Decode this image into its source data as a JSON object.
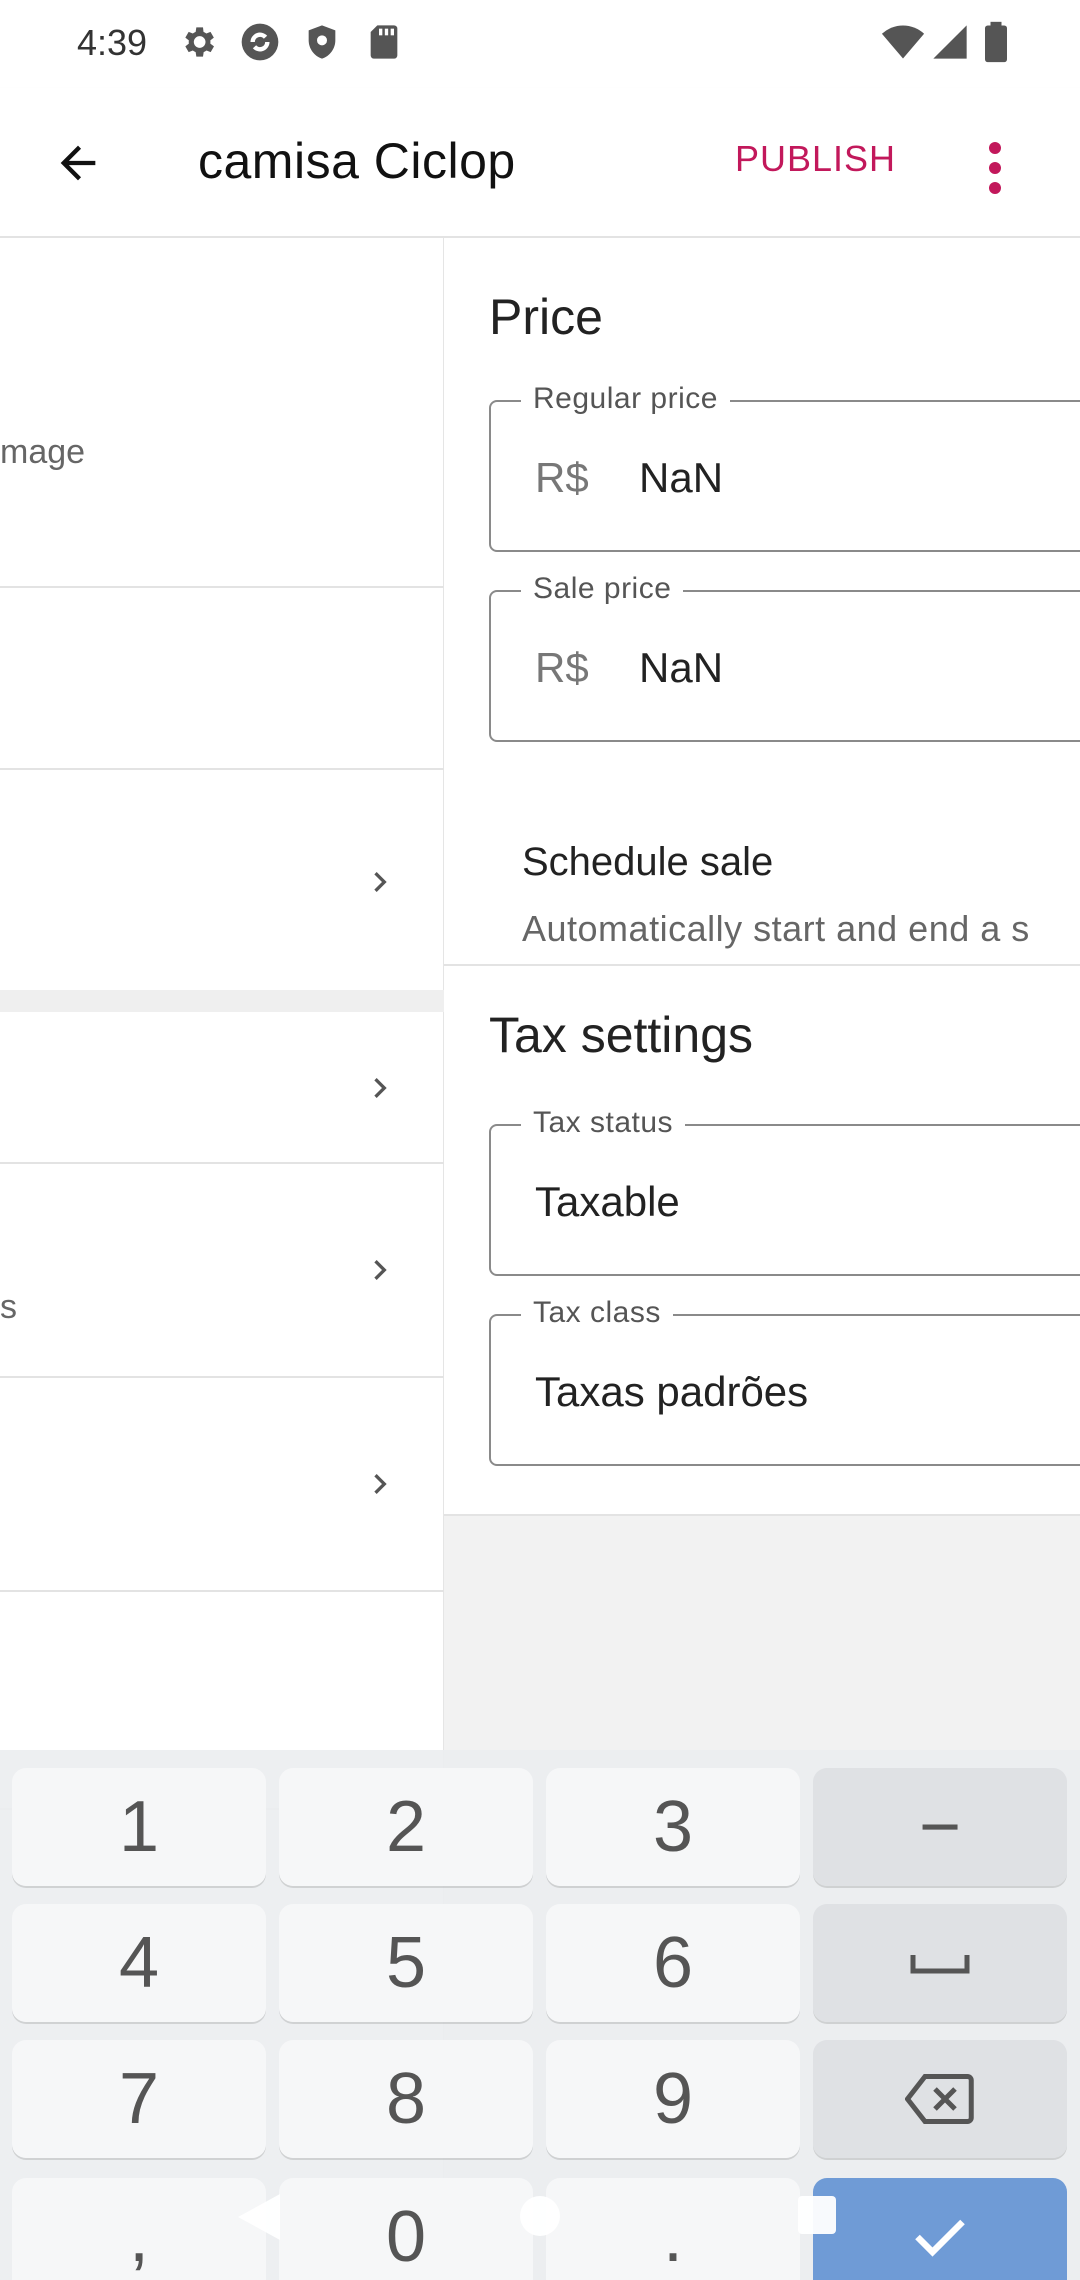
{
  "status_bar": {
    "time": "4:39",
    "icons_left": [
      "settings-icon",
      "sync-icon",
      "shield-icon",
      "sd-card-icon"
    ],
    "icons_right": [
      "wifi-icon",
      "cellular-icon",
      "battery-icon"
    ]
  },
  "app_bar": {
    "back_icon": "arrow-back-icon",
    "title": "camisa Ciclop",
    "publish_label": "PUBLISH",
    "more_icon": "more-vert-icon"
  },
  "left_pane": {
    "image_row_text": "mage",
    "partial_text": "s"
  },
  "price": {
    "section_title": "Price",
    "regular_price_label": "Regular price",
    "regular_price_prefix": "R$",
    "regular_price_value": "NaN",
    "sale_price_label": "Sale price",
    "sale_price_prefix": "R$",
    "sale_price_value": "NaN",
    "schedule_title": "Schedule sale",
    "schedule_subtitle": "Automatically start and end a s"
  },
  "tax": {
    "section_title": "Tax settings",
    "status_label": "Tax status",
    "status_value": "Taxable",
    "class_label": "Tax class",
    "class_value": "Taxas padrões"
  },
  "keyboard": {
    "keys": [
      "1",
      "2",
      "3",
      "−",
      "4",
      "5",
      "6",
      "␣",
      "7",
      "8",
      "9",
      "⌫",
      ",",
      "0",
      ".",
      "✓"
    ]
  },
  "colors": {
    "accent": "#c2185b",
    "done_key": "#6f9bd6"
  }
}
